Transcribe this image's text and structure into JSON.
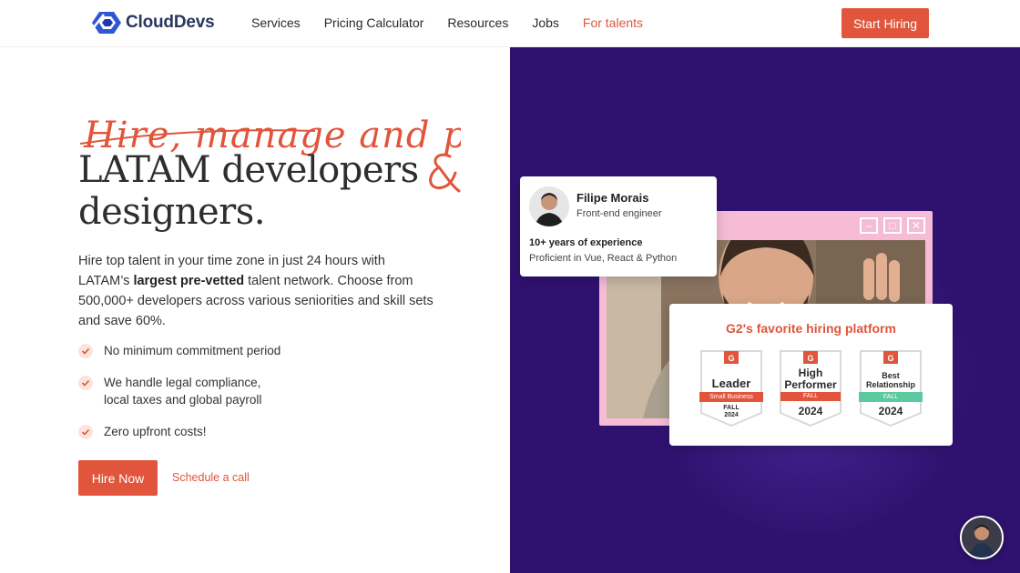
{
  "brand": {
    "name": "CloudDevs"
  },
  "nav": {
    "links": [
      "Services",
      "Pricing Calculator",
      "Resources",
      "Jobs",
      "For talents"
    ],
    "cta": "Start Hiring"
  },
  "hero": {
    "script_heading": "Hire, manage and pay",
    "headline_line1": "LATAM developers",
    "headline_line2": "designers.",
    "desc_part1": "Hire top talent in your time zone in just 24 hours with LATAM’s ",
    "desc_bold": "largest pre-vetted",
    "desc_part2": " talent network. Choose from 500,000+ developers across various seniorities and skill sets and save 60%.",
    "checks": [
      "No minimum commitment period",
      "We handle legal compliance,\nlocal taxes and global payroll",
      "Zero upfront costs!"
    ],
    "primary_cta": "Hire Now",
    "secondary_cta": "Schedule a call"
  },
  "profile_card": {
    "name": "Filipe Morais",
    "role": "Front-end engineer",
    "experience": "10+ years of experience",
    "skills": "Proficient in Vue, React & Python"
  },
  "g2": {
    "title": "G2's favorite hiring platform",
    "badges": [
      {
        "title": "Leader",
        "ribbon": "Small Business",
        "season": "FALL",
        "year": "2024",
        "ribbon_color": "#e0553b"
      },
      {
        "title": "High Performer",
        "ribbon": "FALL",
        "season": "",
        "year": "2024",
        "ribbon_color": "#e0553b"
      },
      {
        "title": "Best Relationship",
        "ribbon": "FALL",
        "season": "",
        "year": "2024",
        "ribbon_color": "#5cc9a0"
      }
    ]
  },
  "colors": {
    "accent": "#e0553b",
    "panel": "#2f1270",
    "window": "#f6bcd6"
  },
  "icons": [
    "logo-icon",
    "check-icon",
    "minimize-icon",
    "maximize-icon",
    "close-icon",
    "g2-logo-icon"
  ]
}
